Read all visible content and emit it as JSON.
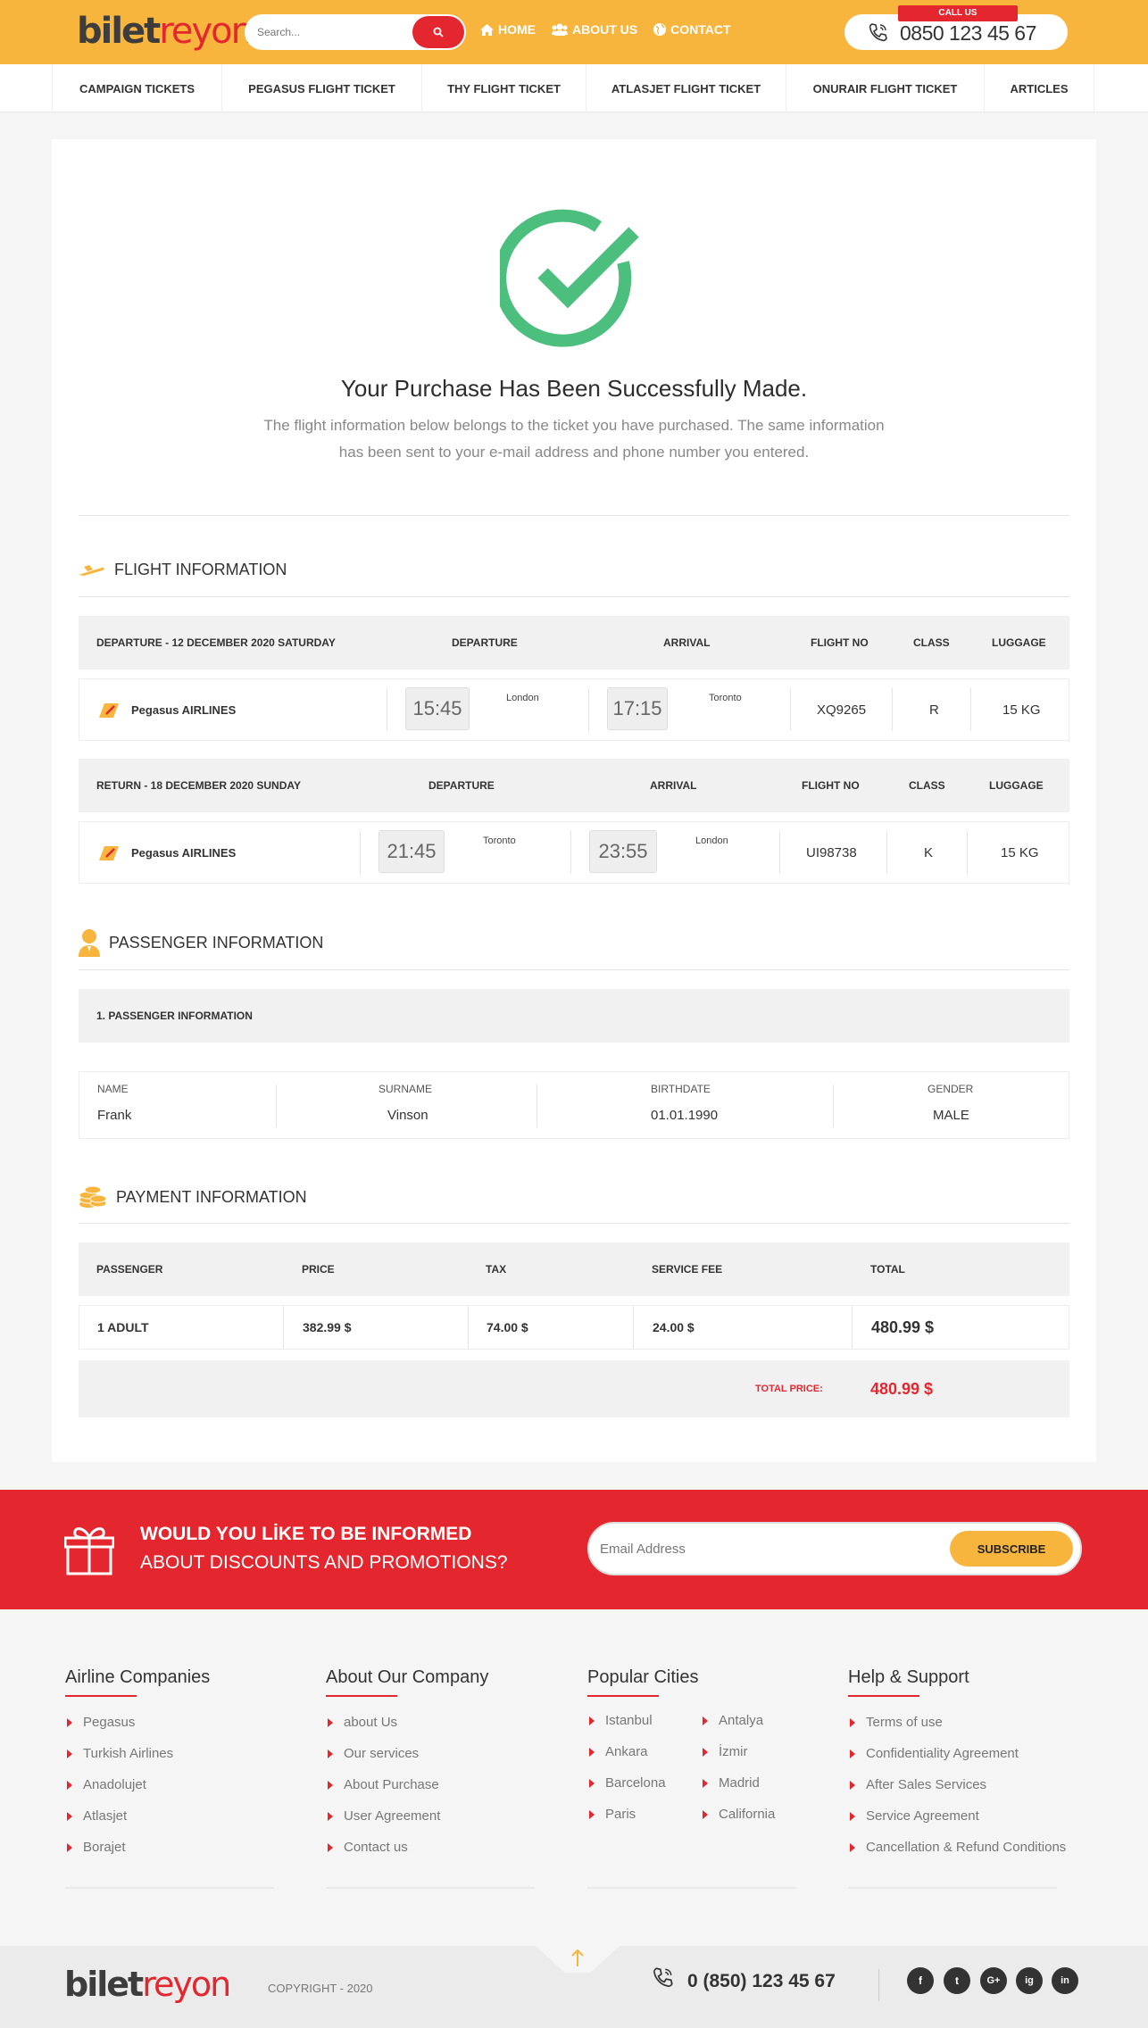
{
  "header": {
    "logo_a": "bilet",
    "logo_b": "reyon",
    "search_placeholder": "Search...",
    "nav": [
      {
        "label": "HOME",
        "icon": "home-icon"
      },
      {
        "label": "ABOUT US",
        "icon": "users-icon"
      },
      {
        "label": "CONTACT",
        "icon": "globe-icon"
      }
    ],
    "call_label": "CALL US",
    "phone": "0850 123 45 67"
  },
  "categories": [
    "CAMPAIGN TICKETS",
    "PEGASUS FLIGHT TICKET",
    "THY FLIGHT TICKET",
    "ATLASJET FLIGHT TICKET",
    "ONURAIR FLIGHT TICKET",
    "ARTICLES"
  ],
  "success": {
    "title": "Your Purchase Has Been Successfully Made.",
    "desc": "The flight information below belongs to the ticket you have purchased. The same information has been sent to your e-mail address and phone number you entered."
  },
  "flight": {
    "heading": "FLIGHT INFORMATION",
    "departure": {
      "label": "DEPARTURE - 12 DECEMBER 2020 SATURDAY",
      "col_dep": "DEPARTURE",
      "col_arr": "ARRIVAL",
      "col_no": "FLIGHT NO",
      "col_class": "CLASS",
      "col_lug": "LUGGAGE",
      "airline": "Pegasus AIRLINES",
      "dep_time": "15:45",
      "dep_city": "London",
      "arr_time": "17:15",
      "arr_city": "Toronto",
      "flight_no": "XQ9265",
      "class": "R",
      "luggage": "15 KG"
    },
    "return": {
      "label": "RETURN - 18 DECEMBER 2020 SUNDAY",
      "col_dep": "DEPARTURE",
      "col_arr": "ARRIVAL",
      "col_no": "FLIGHT NO",
      "col_class": "CLASS",
      "col_lug": "LUGGAGE",
      "airline": "Pegasus AIRLINES",
      "dep_time": "21:45",
      "dep_city": "Toronto",
      "arr_time": "23:55",
      "arr_city": "London",
      "flight_no": "UI98738",
      "class": "K",
      "luggage": "15 KG"
    }
  },
  "passenger": {
    "heading": "PASSENGER INFORMATION",
    "sub": "1. PASSENGER INFORMATION",
    "name_label": "NAME",
    "name": "Frank",
    "surname_label": "SURNAME",
    "surname": "Vinson",
    "birth_label": "BIRTHDATE",
    "birth": "01.01.1990",
    "gender_label": "GENDER",
    "gender": "MALE"
  },
  "payment": {
    "heading": "PAYMENT INFORMATION",
    "cols": [
      "PASSENGER",
      "PRICE",
      "TAX",
      "SERVICE FEE",
      "TOTAL"
    ],
    "row": [
      "1 ADULT",
      "382.99 $",
      "74.00 $",
      "24.00 $",
      "480.99 $"
    ],
    "total_label": "TOTAL PRICE:",
    "total": "480.99 $"
  },
  "subscribe": {
    "title": "WOULD YOU LİKE TO BE INFORMED",
    "subtitle": "ABOUT DISCOUNTS AND PROMOTIONS?",
    "placeholder": "Email Address",
    "button": "SUBSCRIBE"
  },
  "footer": {
    "airlines": {
      "title": "Airline Companies",
      "items": [
        "Pegasus",
        "Turkish Airlines",
        "Anadolujet",
        "Atlasjet",
        "Borajet"
      ]
    },
    "company": {
      "title": "About Our Company",
      "items": [
        "about Us",
        "Our services",
        "About Purchase",
        "User Agreement",
        "Contact us"
      ]
    },
    "cities": {
      "title": "Popular Cities",
      "col1": [
        "Istanbul",
        "Ankara",
        "Barcelona",
        "Paris"
      ],
      "col2": [
        "Antalya",
        "İzmir",
        "Madrid",
        "California"
      ]
    },
    "help": {
      "title": "Help & Support",
      "items": [
        "Terms of use",
        "Confidentiality Agreement",
        "After Sales Services",
        "Service Agreement",
        "Cancellation & Refund Conditions"
      ]
    },
    "copyright": "COPYRIGHT - 2020",
    "phone": "0 (850) 123 45 67",
    "social": [
      "f",
      "t",
      "G+",
      "ig",
      "in"
    ]
  },
  "colors": {
    "accent": "#f8b53e",
    "brand_red": "#e4262f",
    "success_green": "#4cbf7e"
  }
}
